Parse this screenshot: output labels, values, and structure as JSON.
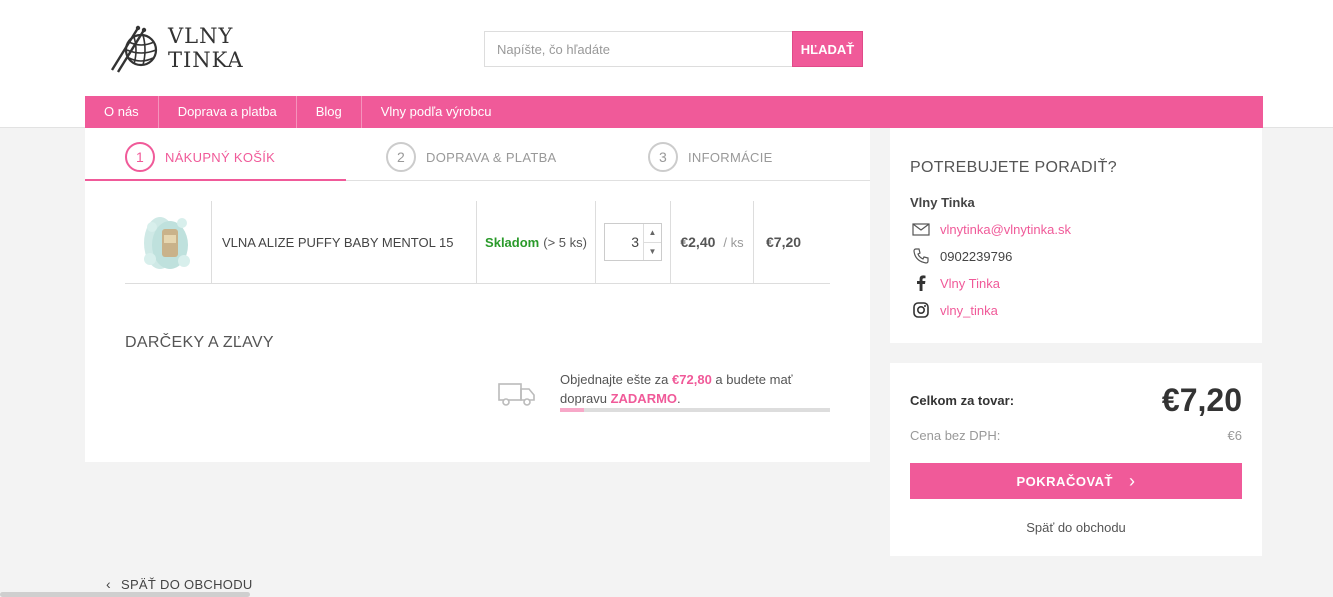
{
  "header": {
    "logo": {
      "line1": "VLNY",
      "line2": "TINKA"
    },
    "search": {
      "placeholder": "Napíšte, čo hľadáte",
      "value": "",
      "button_label": "HĽADAŤ"
    }
  },
  "nav": {
    "items": [
      "O nás",
      "Doprava a platba",
      "Blog",
      "Vlny podľa výrobcu"
    ]
  },
  "steps": [
    {
      "number": "1",
      "label": "NÁKUPNÝ KOŠÍK"
    },
    {
      "number": "2",
      "label": "DOPRAVA & PLATBA"
    },
    {
      "number": "3",
      "label": "INFORMÁCIE"
    }
  ],
  "cart": {
    "item": {
      "name": "VLNA ALIZE PUFFY BABY MENTOL 15",
      "stock_status": "Skladom",
      "stock_count": "(> 5 ks)",
      "quantity": "3",
      "unit_price": "€2,40",
      "unit": "/ ks",
      "total": "€7,20"
    },
    "gifts_title": "DARČEKY A ZĽAVY",
    "shipping": {
      "text_before": "Objednajte ešte za ",
      "amount": "€72,80",
      "text_middle": " a budete mať dopravu ",
      "free_label": "ZADARMO",
      "text_after": ".",
      "progress": 0.09
    }
  },
  "help": {
    "title": "POTREBUJETE PORADIŤ?",
    "name": "Vlny Tinka",
    "email": "vlnytinka@vlnytinka.sk",
    "phone": "0902239796",
    "facebook": "Vlny Tinka",
    "instagram": "vlny_tinka"
  },
  "summary": {
    "total_label": "Celkom za tovar:",
    "total_value": "€7,20",
    "vat_label": "Cena bez DPH:",
    "vat_value": "€6",
    "continue_label": "POKRAČOVAŤ",
    "back_label": "Späť do obchodu"
  },
  "footer": {
    "back_label": "SPÄŤ DO OBCHODU"
  },
  "colors": {
    "accent": "#f05a99",
    "in_stock": "#2a9a2a"
  },
  "icons": [
    "knitting-logo-icon",
    "truck-icon",
    "mail-icon",
    "phone-icon",
    "facebook-icon",
    "instagram-icon",
    "chevron-right-icon",
    "chevron-left-icon"
  ]
}
